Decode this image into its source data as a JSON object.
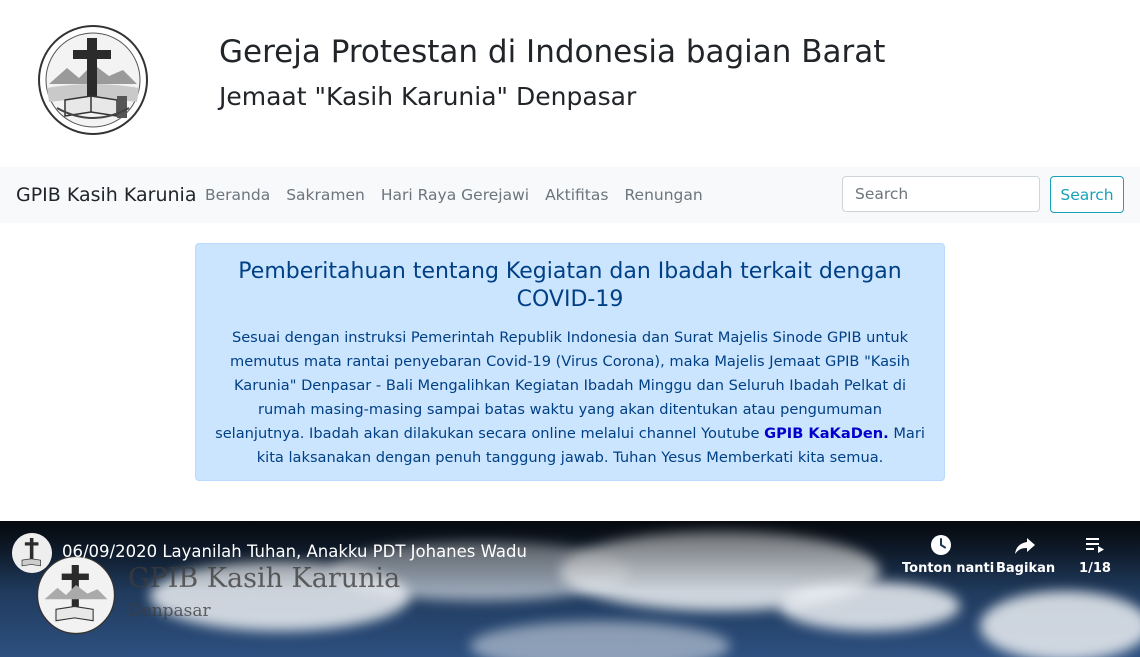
{
  "header": {
    "title": "Gereja Protestan di Indonesia bagian Barat",
    "subtitle": "Jemaat \"Kasih Karunia\" Denpasar"
  },
  "navbar": {
    "brand": "GPIB Kasih Karunia",
    "links": [
      "Beranda",
      "Sakramen",
      "Hari Raya Gerejawi",
      "Aktifitas",
      "Renungan"
    ],
    "search_placeholder": "Search",
    "search_button": "Search",
    "accent_color": "#17a2b8"
  },
  "alert": {
    "heading": "Pemberitahuan tentang Kegiatan dan Ibadah terkait dengan COVID-19",
    "body_before": "Sesuai dengan instruksi Pemerintah Republik Indonesia dan Surat Majelis Sinode GPIB untuk memutus mata rantai penyebaran Covid-19 (Virus Corona), maka Majelis Jemaat GPIB \"Kasih Karunia\" Denpasar - Bali Mengalihkan Kegiatan Ibadah Minggu dan Seluruh Ibadah Pelkat di rumah masing-masing sampai batas waktu yang akan ditentukan atau pengumuman selanjutnya. Ibadah akan dilakukan secara online melalui channel Youtube",
    "link_text": "GPIB KaKaDen.",
    "body_after": "Mari kita laksanakan dengan penuh tanggung jawab. Tuhan Yesus Memberkati kita semua.",
    "background_color": "#cce5ff",
    "text_color": "#004085"
  },
  "video": {
    "title": "06/09/2020 Layanilah Tuhan, Anakku PDT Johanes Wadu",
    "watermark_title": "GPIB Kasih Karunia",
    "watermark_subtitle": "Denpasar",
    "controls": {
      "watch_later": "Tonton nanti",
      "share": "Bagikan",
      "playlist_position": "1/18"
    },
    "icons": [
      "clock-icon",
      "share-icon",
      "playlist-icon"
    ]
  }
}
